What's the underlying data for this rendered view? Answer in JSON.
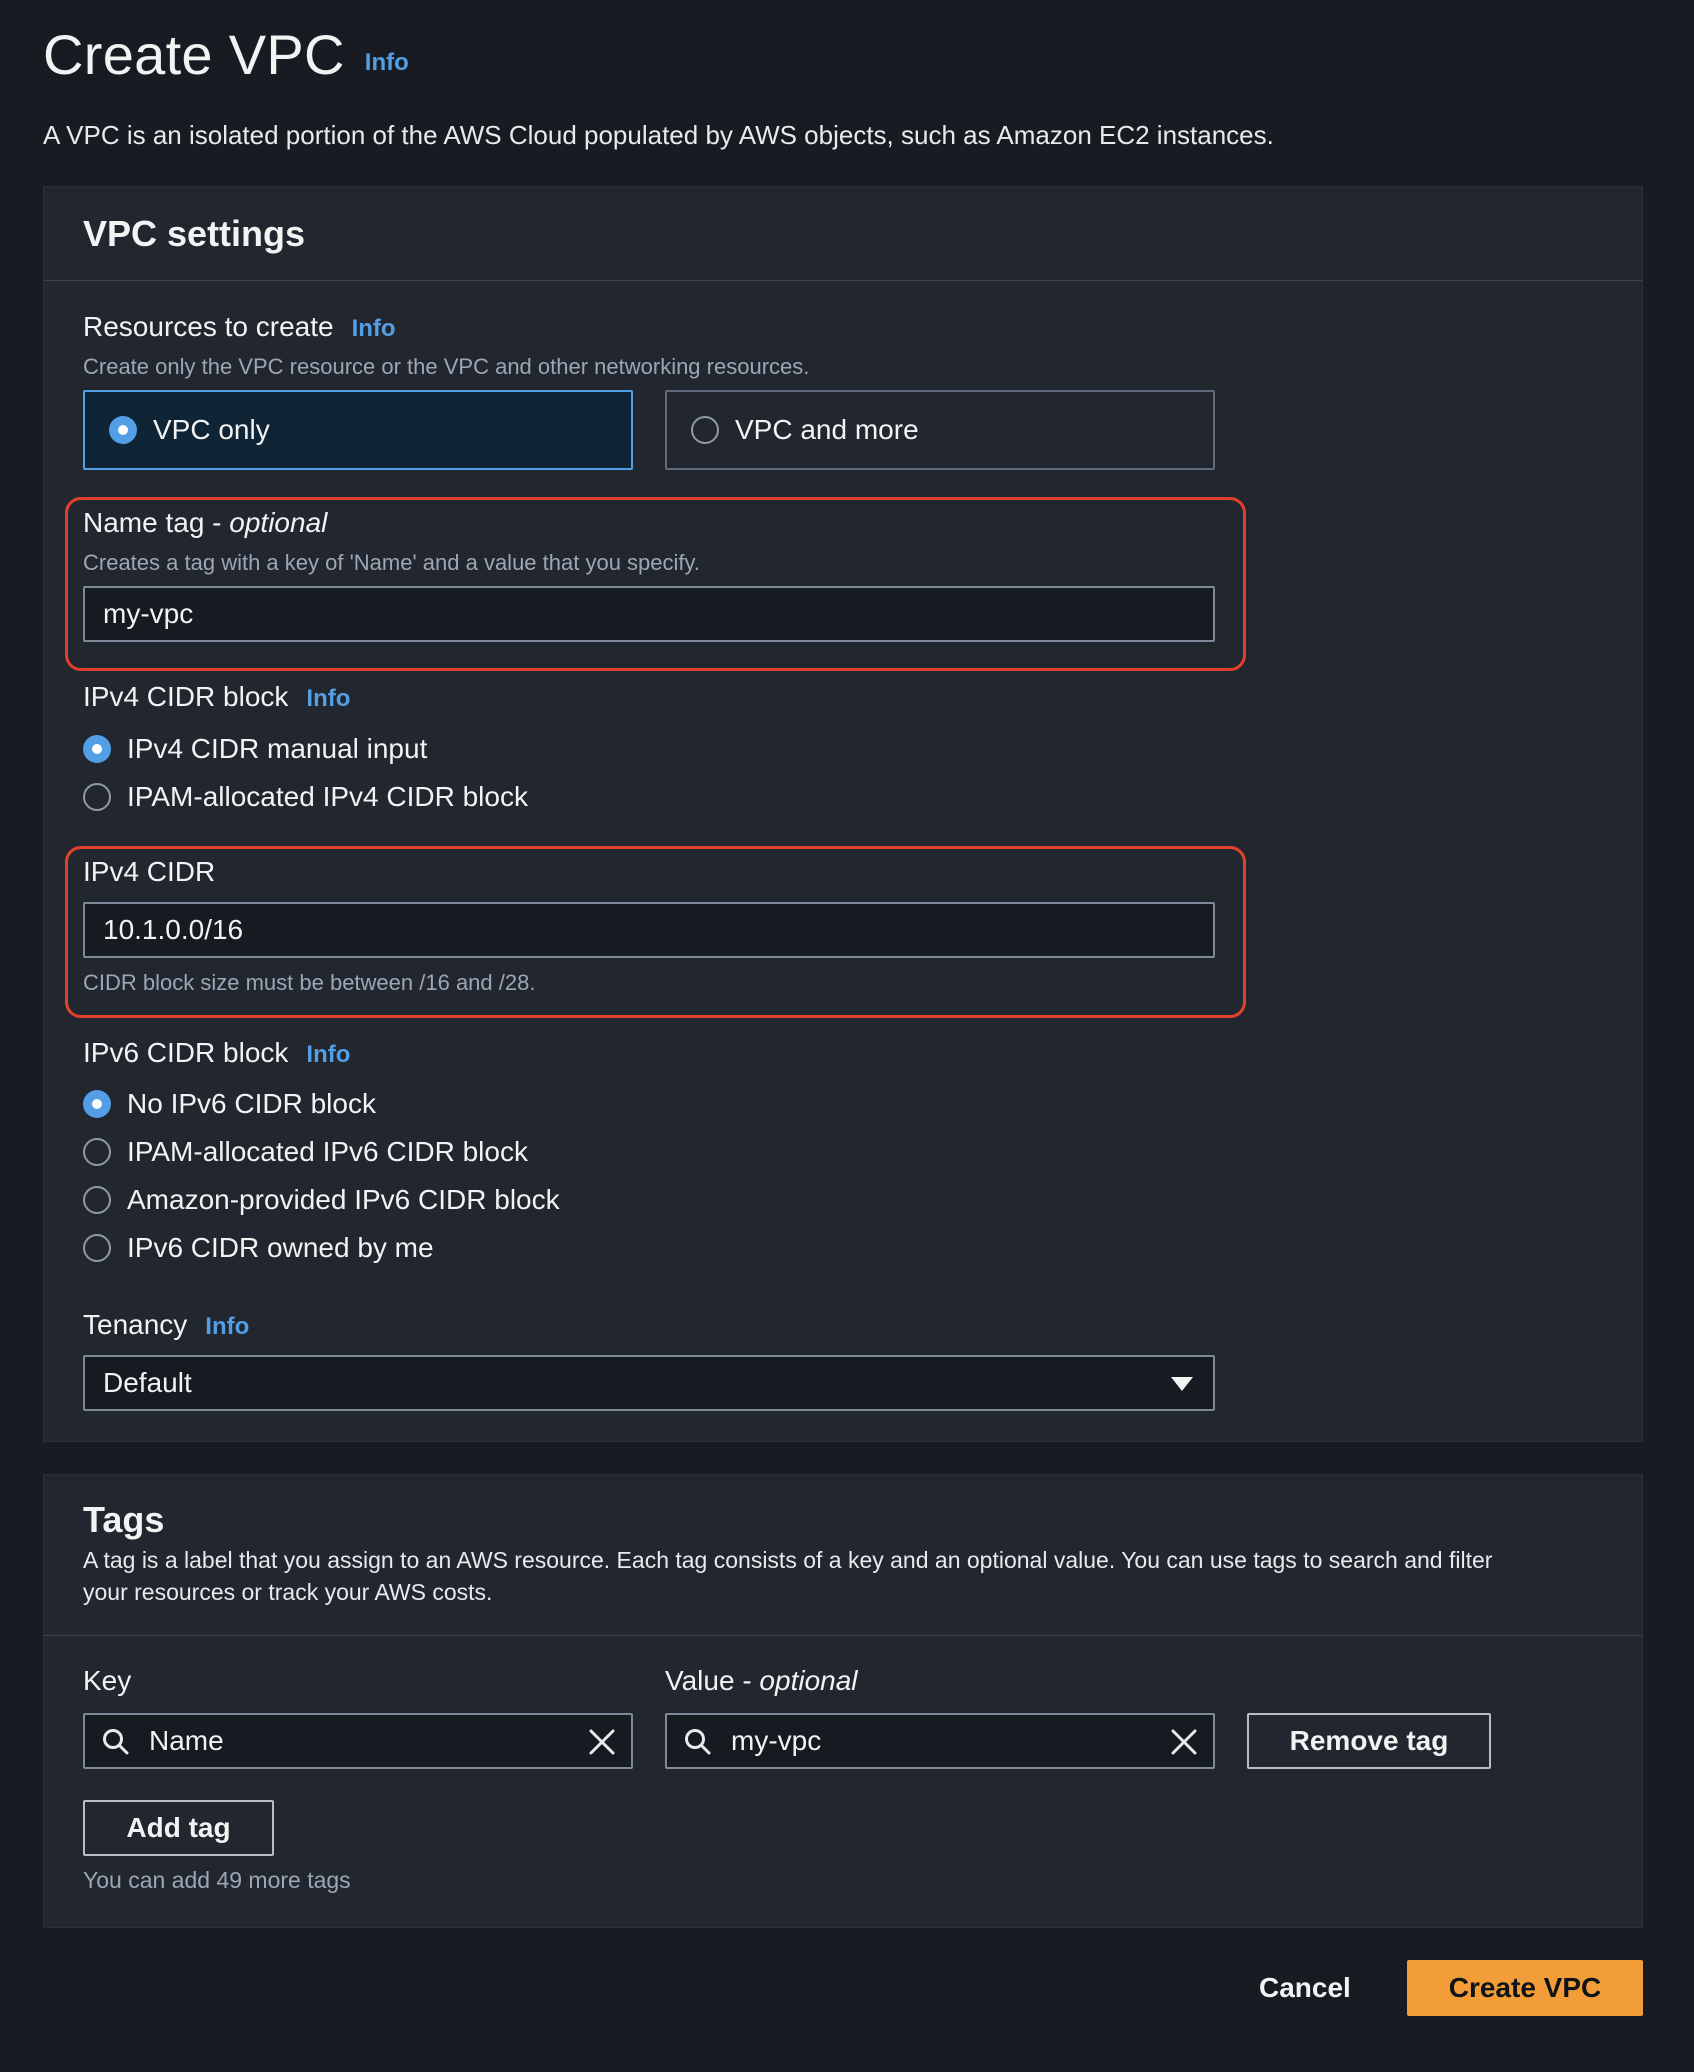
{
  "header": {
    "title": "Create VPC",
    "info": "Info",
    "description": "A VPC is an isolated portion of the AWS Cloud populated by AWS objects, such as Amazon EC2 instances."
  },
  "vpc_settings": {
    "title": "VPC settings",
    "resources": {
      "label": "Resources to create",
      "info": "Info",
      "description": "Create only the VPC resource or the VPC and other networking resources.",
      "options": [
        {
          "label": "VPC only",
          "selected": true
        },
        {
          "label": "VPC and more",
          "selected": false
        }
      ]
    },
    "name_tag": {
      "label": "Name tag - ",
      "optional": "optional",
      "description": "Creates a tag with a key of 'Name' and a value that you specify.",
      "value": "my-vpc"
    },
    "ipv4_block": {
      "label": "IPv4 CIDR block",
      "info": "Info",
      "options": [
        {
          "label": "IPv4 CIDR manual input",
          "selected": true
        },
        {
          "label": "IPAM-allocated IPv4 CIDR block",
          "selected": false
        }
      ]
    },
    "ipv4_cidr": {
      "label": "IPv4 CIDR",
      "value": "10.1.0.0/16",
      "hint": "CIDR block size must be between /16 and /28."
    },
    "ipv6_block": {
      "label": "IPv6 CIDR block",
      "info": "Info",
      "options": [
        {
          "label": "No IPv6 CIDR block",
          "selected": true
        },
        {
          "label": "IPAM-allocated IPv6 CIDR block",
          "selected": false
        },
        {
          "label": "Amazon-provided IPv6 CIDR block",
          "selected": false
        },
        {
          "label": "IPv6 CIDR owned by me",
          "selected": false
        }
      ]
    },
    "tenancy": {
      "label": "Tenancy",
      "info": "Info",
      "value": "Default"
    }
  },
  "tags": {
    "title": "Tags",
    "description_line1": "A tag is a label that you assign to an AWS resource. Each tag consists of a key and an optional value. You can use tags to search and filter",
    "description_line2": "your resources or track your AWS costs.",
    "key_label": "Key",
    "value_label": "Value - ",
    "value_optional": "optional",
    "key_value": "Name",
    "value_value": "my-vpc",
    "remove_label": "Remove tag",
    "add_label": "Add tag",
    "remaining": "You can add 49 more tags"
  },
  "footer": {
    "cancel": "Cancel",
    "create": "Create VPC"
  },
  "colors": {
    "background": "#181b22",
    "panel": "#22262e",
    "accent_blue": "#539fe5",
    "highlight_red": "#e0412c",
    "primary_orange": "#f29d38"
  },
  "icons": [
    "search-icon",
    "close-icon",
    "caret-down-icon"
  ]
}
